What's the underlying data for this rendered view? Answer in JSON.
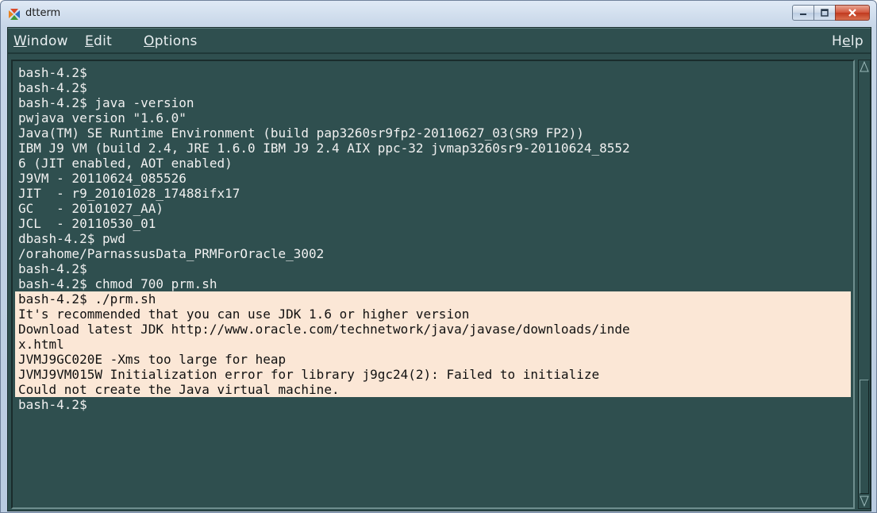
{
  "window": {
    "title": "dtterm"
  },
  "menu": {
    "window": "indow",
    "window_mnemonic": "W",
    "edit": "dit",
    "edit_mnemonic": "E",
    "options": "ptions",
    "options_mnemonic": "O",
    "help_prefix": "H",
    "help_mnemonic": "e",
    "help_suffix": "lp"
  },
  "terminal": {
    "lines": [
      "bash-4.2$",
      "bash-4.2$",
      "bash-4.2$ java -version",
      "pwjava version \"1.6.0\"",
      "Java(TM) SE Runtime Environment (build pap3260sr9fp2-20110627_03(SR9 FP2))",
      "IBM J9 VM (build 2.4, JRE 1.6.0 IBM J9 2.4 AIX ppc-32 jvmap3260sr9-20110624_8552",
      "6 (JIT enabled, AOT enabled)",
      "J9VM - 20110624_085526",
      "JIT  - r9_20101028_17488ifx17",
      "GC   - 20101027_AA)",
      "JCL  - 20110530_01",
      "dbash-4.2$ pwd",
      "/orahome/ParnassusData_PRMForOracle_3002",
      "bash-4.2$",
      "bash-4.2$ chmod 700 prm.sh",
      "bash-4.2$ ./prm.sh",
      "It's recommended that you can use JDK 1.6 or higher version",
      "Download latest JDK http://www.oracle.com/technetwork/java/javase/downloads/inde",
      "x.html",
      "JVMJ9GC020E -Xms too large for heap",
      "JVMJ9VM015W Initialization error for library j9gc24(2): Failed to initialize",
      "Could not create the Java virtual machine.",
      "bash-4.2$"
    ]
  },
  "colors": {
    "terminal_bg": "#2f4f4f",
    "terminal_fg": "#f0f0f0",
    "highlight_bg": "#fbe7d6"
  }
}
